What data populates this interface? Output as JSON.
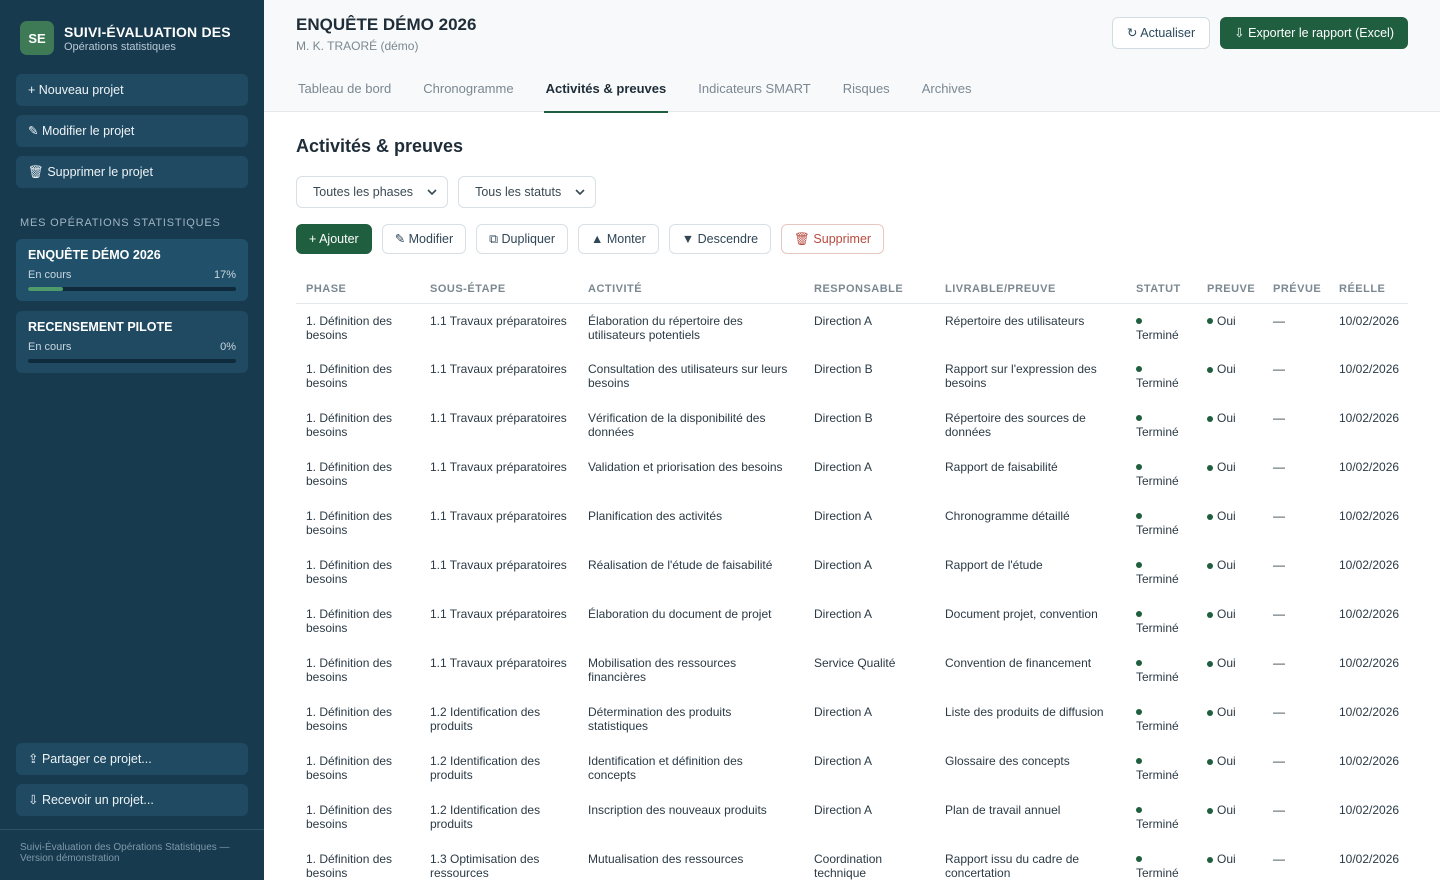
{
  "sidebar": {
    "brand_logo": "SE",
    "brand_title": "SUIVI-ÉVALUATION DES",
    "brand_sub": "Opérations statistiques",
    "buttons": [
      {
        "label": "+ Nouveau projet"
      },
      {
        "label": "✎ Modifier le projet"
      },
      {
        "label": "🗑 Supprimer le projet"
      }
    ],
    "section_label": "MES OPÉRATIONS STATISTIQUES",
    "projects": [
      {
        "name": "ENQUÊTE DÉMO 2026",
        "status": "En cours",
        "progress_label": "17%",
        "progress": 17
      },
      {
        "name": "RECENSEMENT PILOTE",
        "status": "En cours",
        "progress_label": "0%",
        "progress": 0
      }
    ],
    "bottom_buttons": [
      {
        "label": "⇪ Partager ce projet..."
      },
      {
        "label": "⇩ Recevoir un projet..."
      }
    ],
    "footer": "Suivi-Évaluation des Opérations Statistiques — Version démonstration"
  },
  "header": {
    "title": "ENQUÊTE DÉMO 2026",
    "subtitle": "M. K. TRAORÉ (démo)",
    "refresh_label": "↻ Actualiser",
    "export_label": "⇩ Exporter le rapport (Excel)"
  },
  "tabs": [
    {
      "label": "Tableau de bord",
      "active": false
    },
    {
      "label": "Chronogramme",
      "active": false
    },
    {
      "label": "Activités & preuves",
      "active": true
    },
    {
      "label": "Indicateurs SMART",
      "active": false
    },
    {
      "label": "Risques",
      "active": false
    },
    {
      "label": "Archives",
      "active": false
    }
  ],
  "section_title": "Activités & preuves",
  "filters": {
    "phase": "Toutes les phases",
    "status": "Tous les statuts"
  },
  "actions": {
    "add": "+ Ajouter",
    "edit": "✎ Modifier",
    "duplicate": "⧉ Dupliquer",
    "up": "▲ Monter",
    "down": "▼ Descendre",
    "delete": "🗑 Supprimer"
  },
  "table": {
    "columns": [
      "PHASE",
      "SOUS-ÉTAPE",
      "ACTIVITÉ",
      "RESPONSABLE",
      "LIVRABLE/PREUVE",
      "STATUT",
      "PREUVE",
      "PRÉVUE",
      "RÉELLE"
    ],
    "rows": [
      {
        "phase": "1. Définition des besoins",
        "sub": "1.1 Travaux préparatoires",
        "activity": "Élaboration du répertoire des utilisateurs potentiels",
        "owner": "Direction A",
        "deliverable": "Répertoire des utilisateurs",
        "status": "Terminé",
        "proof": "Oui",
        "planned": "—",
        "actual": "10/02/2026"
      },
      {
        "phase": "1. Définition des besoins",
        "sub": "1.1 Travaux préparatoires",
        "activity": "Consultation des utilisateurs sur leurs besoins",
        "owner": "Direction B",
        "deliverable": "Rapport sur l'expression des besoins",
        "status": "Terminé",
        "proof": "Oui",
        "planned": "—",
        "actual": "10/02/2026"
      },
      {
        "phase": "1. Définition des besoins",
        "sub": "1.1 Travaux préparatoires",
        "activity": "Vérification de la disponibilité des données",
        "owner": "Direction B",
        "deliverable": "Répertoire des sources de données",
        "status": "Terminé",
        "proof": "Oui",
        "planned": "—",
        "actual": "10/02/2026"
      },
      {
        "phase": "1. Définition des besoins",
        "sub": "1.1 Travaux préparatoires",
        "activity": "Validation et priorisation des besoins",
        "owner": "Direction A",
        "deliverable": "Rapport de faisabilité",
        "status": "Terminé",
        "proof": "Oui",
        "planned": "—",
        "actual": "10/02/2026"
      },
      {
        "phase": "1. Définition des besoins",
        "sub": "1.1 Travaux préparatoires",
        "activity": "Planification des activités",
        "owner": "Direction A",
        "deliverable": "Chronogramme détaillé",
        "status": "Terminé",
        "proof": "Oui",
        "planned": "—",
        "actual": "10/02/2026"
      },
      {
        "phase": "1. Définition des besoins",
        "sub": "1.1 Travaux préparatoires",
        "activity": "Réalisation de l'étude de faisabilité",
        "owner": "Direction A",
        "deliverable": "Rapport de l'étude",
        "status": "Terminé",
        "proof": "Oui",
        "planned": "—",
        "actual": "10/02/2026"
      },
      {
        "phase": "1. Définition des besoins",
        "sub": "1.1 Travaux préparatoires",
        "activity": "Élaboration du document de projet",
        "owner": "Direction A",
        "deliverable": "Document projet, convention",
        "status": "Terminé",
        "proof": "Oui",
        "planned": "—",
        "actual": "10/02/2026"
      },
      {
        "phase": "1. Définition des besoins",
        "sub": "1.1 Travaux préparatoires",
        "activity": "Mobilisation des ressources financières",
        "owner": "Service Qualité",
        "deliverable": "Convention de financement",
        "status": "Terminé",
        "proof": "Oui",
        "planned": "—",
        "actual": "10/02/2026"
      },
      {
        "phase": "1. Définition des besoins",
        "sub": "1.2 Identification des produits",
        "activity": "Détermination des produits statistiques",
        "owner": "Direction A",
        "deliverable": "Liste des produits de diffusion",
        "status": "Terminé",
        "proof": "Oui",
        "planned": "—",
        "actual": "10/02/2026"
      },
      {
        "phase": "1. Définition des besoins",
        "sub": "1.2 Identification des produits",
        "activity": "Identification et définition des concepts",
        "owner": "Direction A",
        "deliverable": "Glossaire des concepts",
        "status": "Terminé",
        "proof": "Oui",
        "planned": "—",
        "actual": "10/02/2026"
      },
      {
        "phase": "1. Définition des besoins",
        "sub": "1.2 Identification des produits",
        "activity": "Inscription des nouveaux produits",
        "owner": "Direction A",
        "deliverable": "Plan de travail annuel",
        "status": "Terminé",
        "proof": "Oui",
        "planned": "—",
        "actual": "10/02/2026"
      },
      {
        "phase": "1. Définition des besoins",
        "sub": "1.3 Optimisation des ressources",
        "activity": "Mutualisation des ressources",
        "owner": "Coordination technique",
        "deliverable": "Rapport issu du cadre de concertation",
        "status": "Terminé",
        "proof": "Oui",
        "planned": "—",
        "actual": "10/02/2026"
      }
    ]
  }
}
